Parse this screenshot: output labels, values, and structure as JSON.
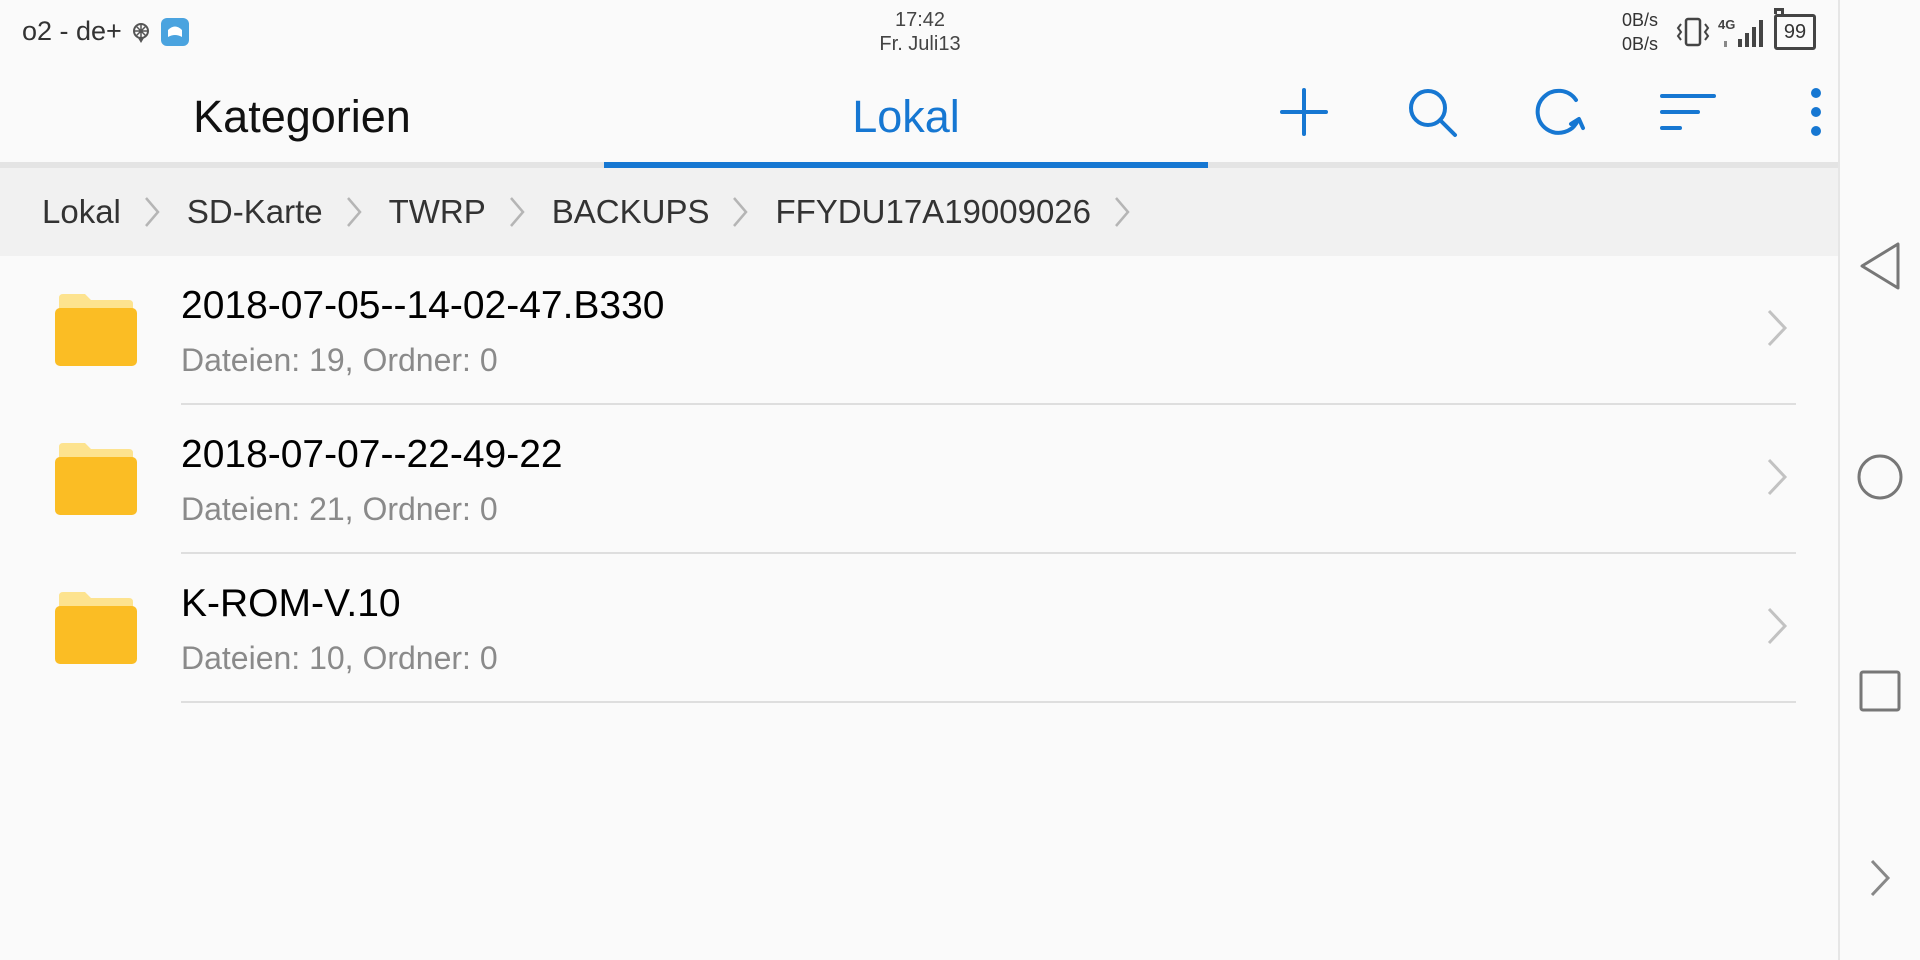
{
  "status_bar": {
    "carrier": "o2 - de+",
    "time": "17:42",
    "date": "Fr. Juli13",
    "speed_up": "0B/s",
    "speed_down": "0B/s",
    "network": "4G",
    "battery": "99"
  },
  "appbar": {
    "tab_categories": "Kategorien",
    "tab_local": "Lokal",
    "actions": [
      "plus-icon",
      "search-icon",
      "refresh-icon",
      "sort-icon",
      "more-vert-icon"
    ]
  },
  "breadcrumb": [
    "Lokal",
    "SD-Karte",
    "TWRP",
    "BACKUPS",
    "FFYDU17A19009026"
  ],
  "files": [
    {
      "name": "2018-07-05--14-02-47.B330",
      "meta": "Dateien: 19, Ordner: 0"
    },
    {
      "name": "2018-07-07--22-49-22",
      "meta": "Dateien: 21, Ordner: 0"
    },
    {
      "name": "K-ROM-V.10",
      "meta": "Dateien: 10, Ordner: 0"
    }
  ],
  "colors": {
    "accent": "#1677d2",
    "folder": "#fbbd24",
    "folder_tab": "#fde38f"
  }
}
